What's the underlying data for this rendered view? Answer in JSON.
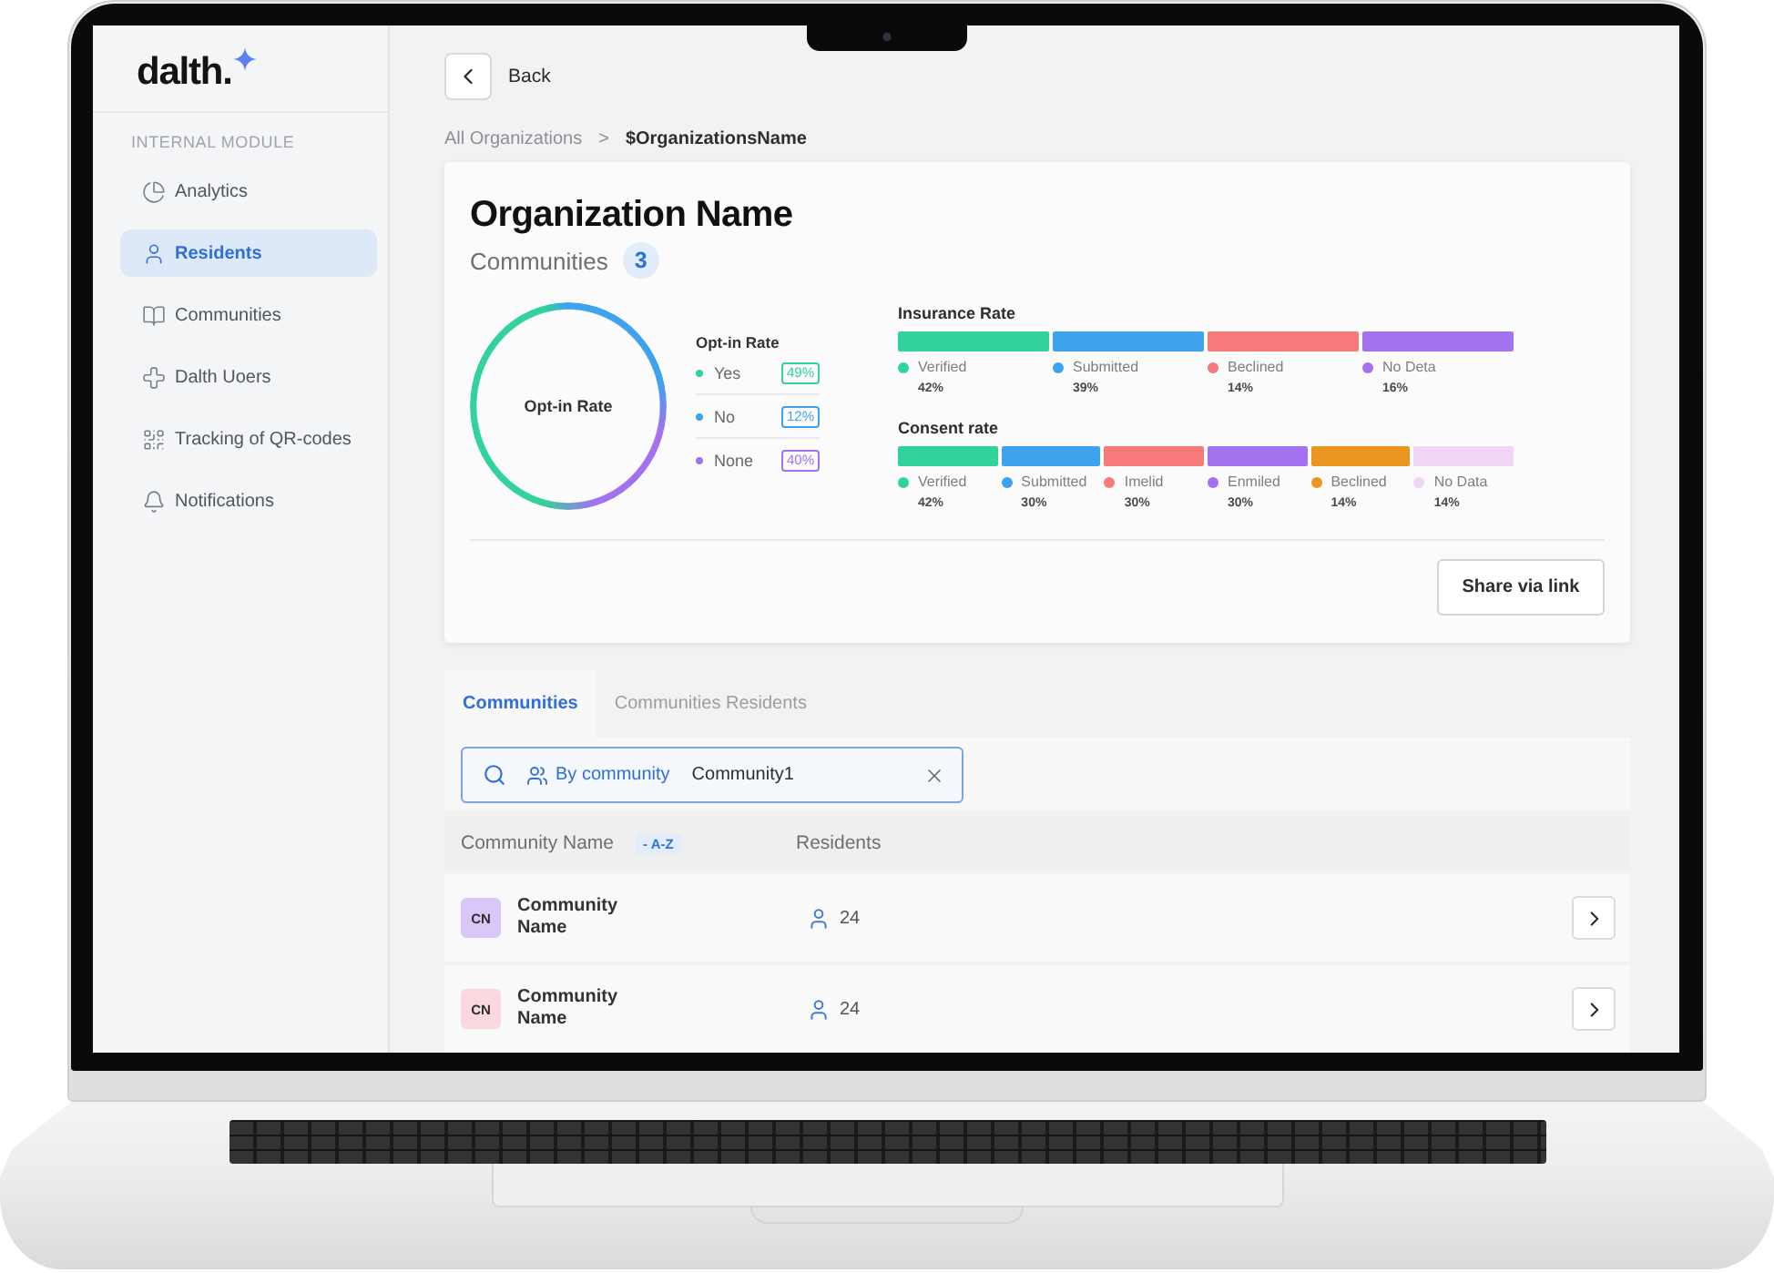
{
  "sidebar": {
    "logo": "dalth.",
    "section_label": "INTERNAL MODULE",
    "items": [
      {
        "label": "Analytics",
        "selected": false
      },
      {
        "label": "Residents",
        "selected": true
      },
      {
        "label": "Communities",
        "selected": false
      },
      {
        "label": "Dalth Uoers",
        "selected": false
      },
      {
        "label": "Tracking of QR-codes",
        "selected": false
      },
      {
        "label": "Notifications",
        "selected": false
      }
    ]
  },
  "back_button": {
    "label": "Back"
  },
  "breadcrumb": {
    "separator": ">",
    "items": [
      {
        "label": "All Organizations",
        "current": false
      },
      {
        "label": "$OrganizationsName",
        "current": true
      }
    ]
  },
  "organization": {
    "title": "Organization Name",
    "communities_label": "Communities",
    "communities_count": "3"
  },
  "opt_in": {
    "center_label": "Opt-in Rate",
    "legend_title": "Opt-in Rate",
    "items": [
      {
        "label": "Yes",
        "value": "49%",
        "color": "#31d39a"
      },
      {
        "label": "No",
        "value": "12%",
        "color": "#3ea2ee"
      },
      {
        "label": "None",
        "value": "40%",
        "color": "#a272f1"
      }
    ]
  },
  "insurance_rate": {
    "title": "Insurance Rate",
    "items": [
      {
        "label": "Verified",
        "value": "42%",
        "color": "#31d39a"
      },
      {
        "label": "Submitted",
        "value": "39%",
        "color": "#3ea2ee"
      },
      {
        "label": "Beclined",
        "value": "14%",
        "color": "#f77a7a"
      },
      {
        "label": "No Deta",
        "value": "16%",
        "color": "#a272f1"
      }
    ]
  },
  "consent_rate": {
    "title": "Consent rate",
    "items": [
      {
        "label": "Verified",
        "value": "42%",
        "color": "#31d39a"
      },
      {
        "label": "Submitted",
        "value": "30%",
        "color": "#3ea2ee"
      },
      {
        "label": "Imelid",
        "value": "30%",
        "color": "#f77a7a"
      },
      {
        "label": "Enmiled",
        "value": "30%",
        "color": "#a272f1"
      },
      {
        "label": "Beclined",
        "value": "14%",
        "color": "#e8961f"
      },
      {
        "label": "No Data",
        "value": "14%",
        "color": "#f0d6f4"
      }
    ]
  },
  "share_button": {
    "label": "Share via link"
  },
  "tabs": [
    {
      "label": "Communities",
      "selected": true
    },
    {
      "label": "Communities Residents",
      "selected": false
    }
  ],
  "search": {
    "filter_label": "By community",
    "value": "Community1"
  },
  "table": {
    "columns": [
      {
        "label": "Community Name",
        "sort": "- A-Z"
      },
      {
        "label": "Residents"
      }
    ],
    "rows": [
      {
        "initials": "CN",
        "name": "Community Name",
        "residents": "24",
        "color": "#dac7f8"
      },
      {
        "initials": "CN",
        "name": "Community Name",
        "residents": "24",
        "color": "#f9d8e0"
      }
    ]
  }
}
